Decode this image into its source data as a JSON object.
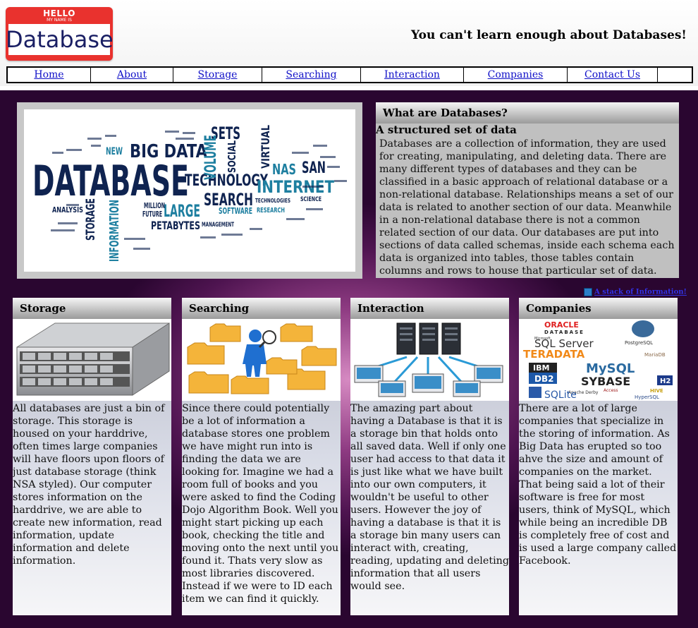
{
  "header": {
    "logo": {
      "hello": "HELLO",
      "my_name_is": "MY NAME IS",
      "word": "Database"
    },
    "tagline": "You can't learn enough about Databases!"
  },
  "nav": [
    "Home",
    "About",
    "Storage",
    "Searching",
    "Interaction",
    "Companies",
    "Contact Us"
  ],
  "hero": {
    "wordcloud": [
      "DATABASE",
      "BIG DATA",
      "TECHNOLOGY",
      "INTERNET",
      "SETS",
      "VOLUME",
      "SEARCH",
      "LARGE",
      "SOCIAL",
      "NAS",
      "SAN",
      "VIRTUAL",
      "STORAGE",
      "INFORMATION",
      "ANALYSIS",
      "NEW",
      "SOFTWARE",
      "MILLION",
      "FUTURE",
      "PETABYTES",
      "MANAGEMENT",
      "TECHNOLOGIES",
      "RESEARCH",
      "SCIENCE"
    ]
  },
  "what": {
    "heading": "What are Databases?",
    "subheading": "A structured set of data",
    "body": "Databases are a collection of information, they are used for creating, manipulating, and deleting data. There are many different types of databases and they can be classified in a basic approach of relational database or a non-relational database. Relationships means a set of our data is related to another section of our data. Meanwhile in a non-relational database there is not a common related section of our data. Our databases are put into sections of data called schemas, inside each schema each data is organized into tables, those tables contain columns and rows to house that particular set of data."
  },
  "stack_link": "A stack of Information!",
  "cards": [
    {
      "title": "Storage",
      "body": "All databases are just a bin of storage. This storage is housed on your harddrive, often times large companies will have floors upon floors of just database storage (think NSA styled). Our computer stores information on the harddrive, we are able to create new information, read information, update information and delete information."
    },
    {
      "title": "Searching",
      "body": "Since there could potentially be a lot of information a database stores one problem we have might run into is finding the data we are looking for. Imagine we had a room full of books and you were asked to find the Coding Dojo Algorithm Book. Well you might start picking up each book, checking the title and moving onto the next until you found it. Thats very slow as most libraries discovered. Instead if we were to ID each item we can find it quickly."
    },
    {
      "title": "Interaction",
      "body": "The amazing part about having a Database is that it is a storage bin that holds onto all saved data. Well if only one user had access to that data it is just like what we have built into our own computers, it wouldn't be useful to other users. However the joy of having a database is that it is a storage bin many users can interact with, creating, reading, updating and deleting information that all users would see."
    },
    {
      "title": "Companies",
      "body": "There are a lot of large companies that specialize in the storing of information. As Big Data has erupted so too ahve the size and amount of companies on the market. That being said a lot of their software is free for most users, think of MySQL, which while being an incredible DB is completely free of cost and is used a large company called Facebook."
    }
  ],
  "logos": {
    "oracle": "ORACLE",
    "oracle_sub": "DATABASE",
    "sqlserver": "SQL Server",
    "microsoft": "Microsoft",
    "postgres": "PostgreSQL",
    "teradata": "TERADATA",
    "mariadb": "MariaDB",
    "ibm": "IBM",
    "db2": "DB2",
    "mysql": "MySQL",
    "sybase": "SYBASE",
    "h2": "H2",
    "access": "Access",
    "derby": "Apache Derby",
    "hive": "HIVE",
    "sqlite": "SQLite",
    "hypersql": "HyperSQL"
  },
  "colors": {
    "nav_link": "#1010c8",
    "logo_red": "#e9322e",
    "logo_text": "#1a1f64",
    "wordcloud_navy": "#0f2350",
    "wordcloud_teal": "#1e7fa0"
  }
}
